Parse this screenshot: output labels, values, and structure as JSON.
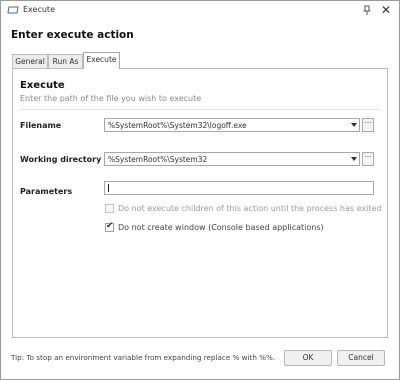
{
  "window": {
    "title": "Execute",
    "icon": "app-window-icon",
    "controls": [
      "pin-icon",
      "close-icon"
    ],
    "close_glyph": "✕"
  },
  "header": {
    "title": "Enter execute action"
  },
  "tabs": [
    {
      "label": "General",
      "active": false
    },
    {
      "label": "Run As",
      "active": false
    },
    {
      "label": "Execute",
      "active": true
    }
  ],
  "section": {
    "title": "Execute",
    "description": "Enter the path of the file you wish to execute"
  },
  "fields": {
    "filename": {
      "label": "Filename",
      "value": "%SystemRoot%\\System32\\logoff.exe",
      "browse_label": "···"
    },
    "working_directory": {
      "label": "Working directory",
      "value": "%SystemRoot%\\System32",
      "browse_label": "···"
    },
    "parameters": {
      "label": "Parameters",
      "value": ""
    }
  },
  "options": {
    "wait_children": {
      "label": "Do not execute children of this action until the process has exited",
      "checked": false,
      "enabled": false
    },
    "no_window": {
      "label": "Do not create window (Console based applications)",
      "checked": true,
      "enabled": true,
      "mark": "✔"
    }
  },
  "footer": {
    "tip": "Tip: To stop an environment variable from expanding replace % with %%.",
    "ok_label": "OK",
    "cancel_label": "Cancel"
  },
  "colors": {
    "panel_border": "#bcbcbc",
    "description": "#8a8a8a",
    "window_border": "#9a9a9a"
  }
}
